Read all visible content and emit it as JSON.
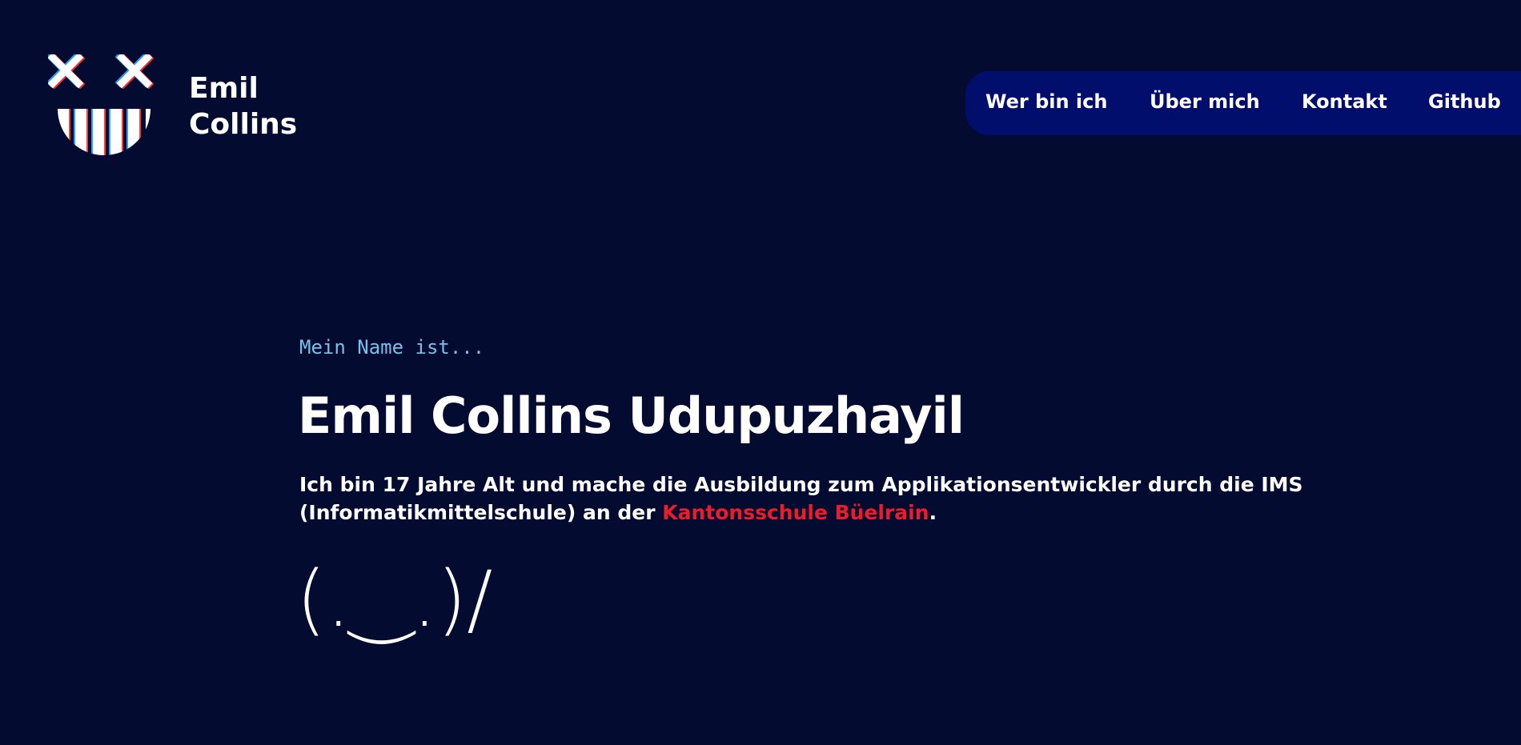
{
  "brand": {
    "first": "Emil",
    "last": "Collins",
    "logo_icon": "smiley-logo-icon"
  },
  "nav": {
    "items": [
      {
        "label": "Wer bin ich"
      },
      {
        "label": "Über mich"
      },
      {
        "label": "Kontakt"
      },
      {
        "label": "Github"
      }
    ]
  },
  "hero": {
    "intro": "Mein Name ist...",
    "name": "Emil Collins Udupuzhayil",
    "bio_before": "Ich bin 17 Jahre Alt und mache die Ausbildung zum Applikationsentwickler durch die IMS (Informatikmittelschule) an der ",
    "bio_link": "Kantonsschule Büelrain",
    "bio_after": ".",
    "kaomoji": "(.‿.)/"
  },
  "colors": {
    "background": "#040b30",
    "nav_background": "#020e6c",
    "accent_link": "#ee1c2a",
    "intro_text": "#79c0ea"
  }
}
